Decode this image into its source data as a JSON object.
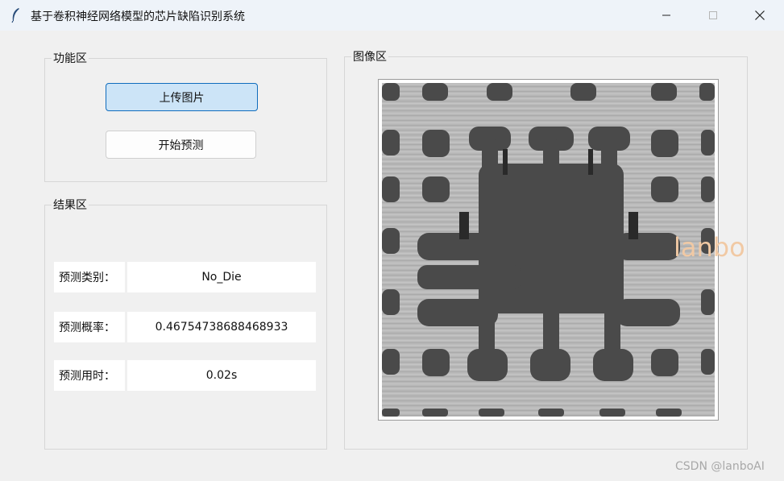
{
  "window": {
    "title": "基于卷积神经网络模型的芯片缺陷识别系统",
    "icon": "feather-icon",
    "controls": [
      "minimize-icon",
      "maximize-icon",
      "close-icon"
    ]
  },
  "function_area": {
    "label": "功能区",
    "upload_button": "上传图片",
    "predict_button": "开始预测"
  },
  "result_area": {
    "label": "结果区",
    "rows": [
      {
        "label": "预测类别：",
        "value": "No_Die"
      },
      {
        "label": "预测概率：",
        "value": "0.46754738688468933"
      },
      {
        "label": "预测用时：",
        "value": "0.02s"
      }
    ]
  },
  "image_area": {
    "label": "图像区",
    "image_icon": "chip-wafer-image"
  },
  "watermarks": {
    "image_overlay": "lanbo",
    "footer": "CSDN @lanboAI"
  },
  "colors": {
    "titlebar": "#eef3f9",
    "background": "#f0f0f0",
    "active_button": "#cce4f7",
    "active_border": "#0f6cbd",
    "chip_dark": "#4a4a4a",
    "chip_light": "#b8b8b8"
  }
}
